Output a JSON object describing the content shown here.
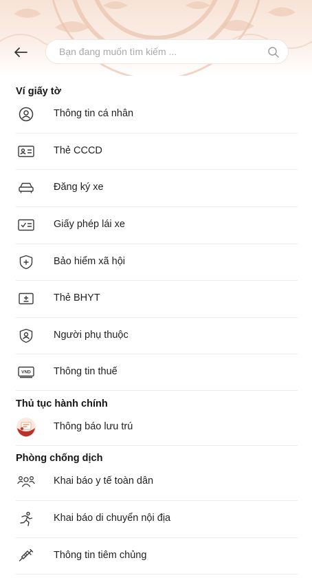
{
  "search": {
    "placeholder": "Bạn đang muốn tìm kiếm ..."
  },
  "sections": [
    {
      "title": "Ví giấy tờ",
      "items": [
        {
          "label": "Thông tin cá nhân",
          "icon": "user-circle-icon"
        },
        {
          "label": "Thẻ CCCD",
          "icon": "id-card-icon"
        },
        {
          "label": "Đăng ký xe",
          "icon": "car-icon"
        },
        {
          "label": "Giấy phép lái xe",
          "icon": "license-check-icon"
        },
        {
          "label": "Bảo hiểm xã hội",
          "icon": "shield-plus-icon"
        },
        {
          "label": "Thẻ BHYT",
          "icon": "health-card-icon"
        },
        {
          "label": "Người phụ thuộc",
          "icon": "shield-user-icon"
        },
        {
          "label": "Thông tin thuế",
          "icon": "vnd-tax-icon",
          "icon_text": "VND"
        }
      ]
    },
    {
      "title": "Thủ tục hành chính",
      "items": [
        {
          "label": "Thông báo lưu trú",
          "icon": "residence-notice-icon"
        }
      ]
    },
    {
      "title": "Phòng chống dịch",
      "items": [
        {
          "label": "Khai báo y tế toàn dân",
          "icon": "people-group-icon"
        },
        {
          "label": "Khai báo di chuyển nội địa",
          "icon": "running-person-icon"
        },
        {
          "label": "Thông tin tiêm chủng",
          "icon": "syringe-icon"
        }
      ]
    }
  ],
  "colors": {
    "accent": "#b8322a",
    "header_bg": "#f7e3d6",
    "icon": "#3a3a3a"
  }
}
